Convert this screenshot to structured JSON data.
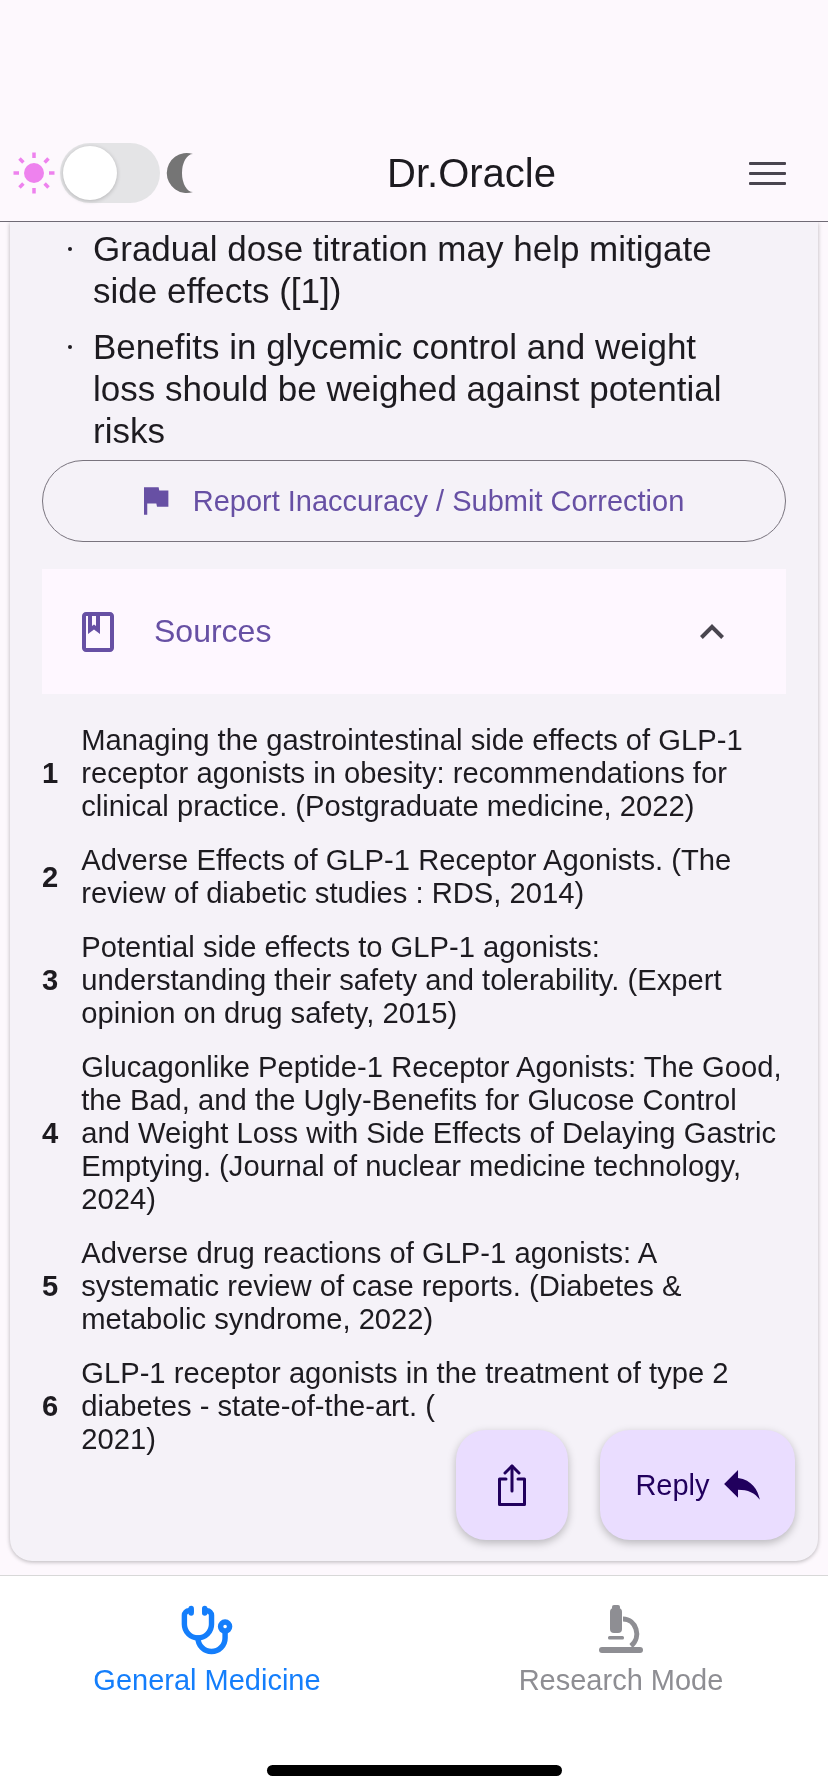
{
  "header": {
    "title": "Dr.Oracle",
    "theme_toggle": {
      "on": false
    }
  },
  "answer": {
    "bullets": [
      "Gradual dose titration may help mitigate side effects ([1])",
      "Benefits in glycemic control and weight loss should be weighed against potential risks"
    ]
  },
  "report_button": {
    "label": "Report Inaccuracy / Submit Correction"
  },
  "sources": {
    "title": "Sources",
    "expanded": true,
    "items": [
      {
        "number": "1",
        "text": "Managing the gastrointestinal side effects of GLP-1 receptor agonists in obesity: recommendations for clinical practice. (Postgraduate medicine, 2022)"
      },
      {
        "number": "2",
        "text": "Adverse Effects of GLP-1 Receptor Agonists. (The review of diabetic studies : RDS, 2014)"
      },
      {
        "number": "3",
        "text": "Potential side effects to GLP-1 agonists: understanding their safety and tolerability. (Expert opinion on drug safety, 2015)"
      },
      {
        "number": "4",
        "text": "Glucagonlike Peptide-1 Receptor Agonists: The Good, the Bad, and the Ugly-Benefits for Glucose Control and Weight Loss with Side Effects of Delaying Gastric Emptying. (Journal of nuclear medicine technology, 2024)"
      },
      {
        "number": "5",
        "text": "Adverse drug reactions of GLP-1 agonists: A systematic review of case reports. (Diabetes & metabolic syndrome, 2022)"
      },
      {
        "number": "6",
        "text": "GLP-1 receptor agonists in the treatment of type 2 diabetes - state-of-the-art. (",
        "text_end": "2021)"
      }
    ]
  },
  "actions": {
    "reply_label": "Reply"
  },
  "bottom_tabs": [
    {
      "label": "General Medicine",
      "selected": true
    },
    {
      "label": "Research Mode",
      "selected": false
    }
  ]
}
